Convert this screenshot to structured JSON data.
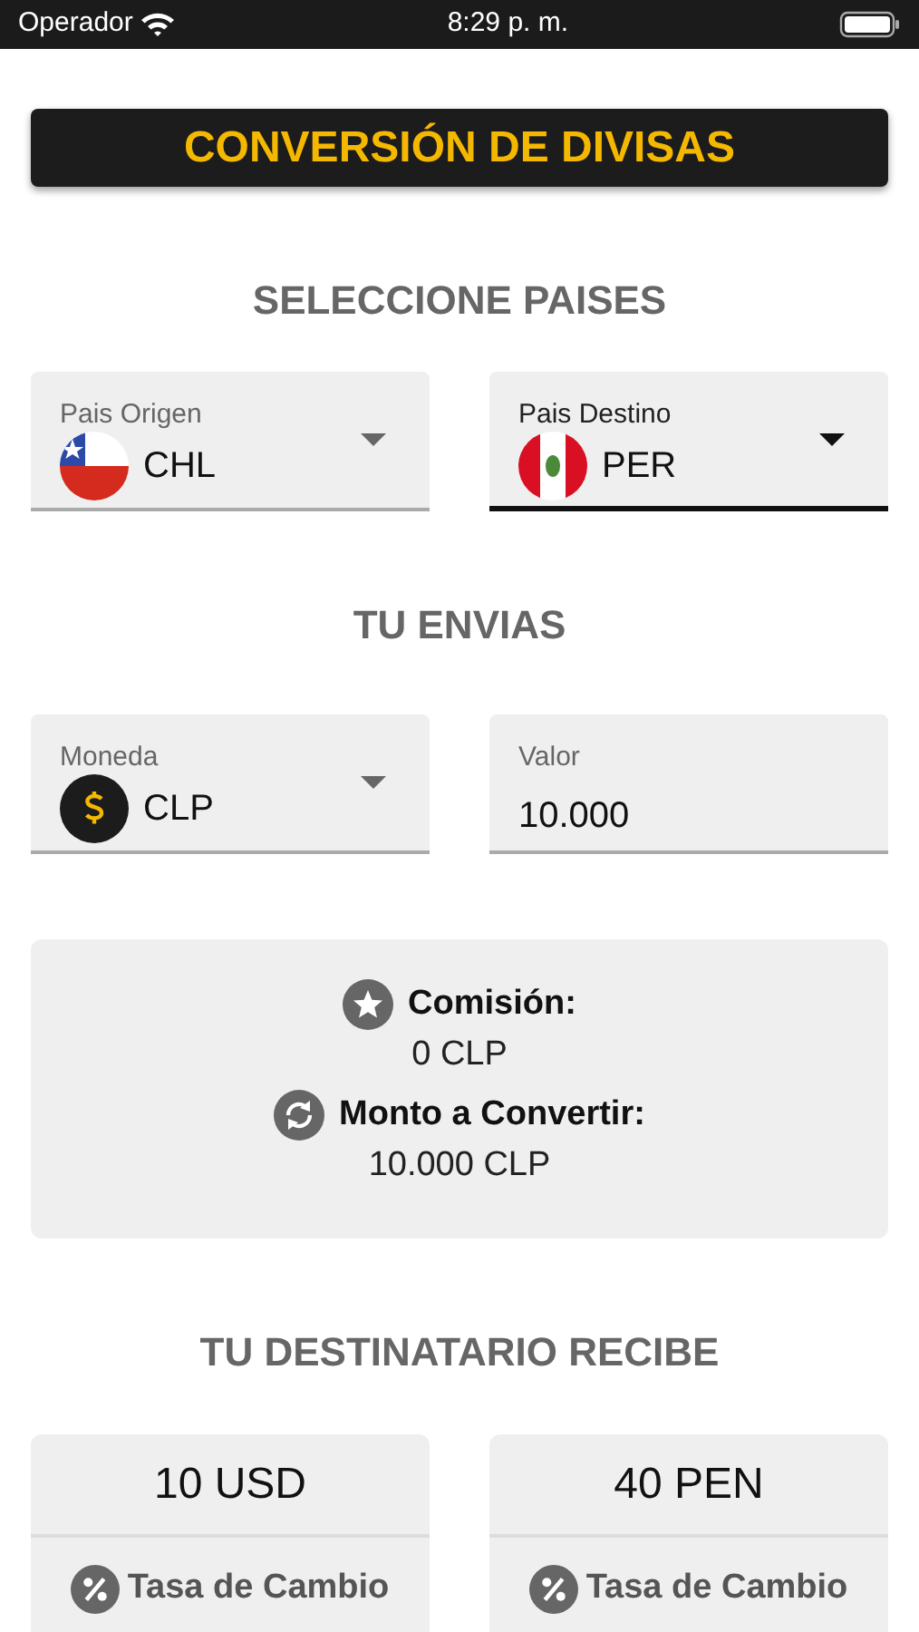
{
  "status_bar": {
    "carrier": "Operador",
    "time": "8:29 p. m."
  },
  "title": "CONVERSIÓN DE DIVISAS",
  "countries_heading": "SELECCIONE PAISES",
  "country_fields": [
    {
      "label": "Pais Origen",
      "value": "CHL",
      "kind": "chile",
      "focused": false
    },
    {
      "label": "Pais Destino",
      "value": "PER",
      "kind": "peru",
      "focused": true
    }
  ],
  "send_heading": "TU ENVIAS",
  "send_fields": [
    {
      "kind": "select",
      "label": "Moneda",
      "value": "CLP",
      "focused": false
    },
    {
      "kind": "input",
      "label": "Valor",
      "value": "10.000",
      "focused": false
    }
  ],
  "summary": [
    {
      "label": "Comisión:",
      "value": "0 CLP"
    },
    {
      "label": "Monto a Convertir:",
      "value": "10.000 CLP"
    }
  ],
  "receive_heading": "TU DESTINATARIO RECIBE",
  "receive_cards": [
    {
      "amount": "10 USD",
      "rate_label": "Tasa de Cambio"
    },
    {
      "amount": "40 PEN",
      "rate_label": "Tasa de Cambio"
    }
  ]
}
